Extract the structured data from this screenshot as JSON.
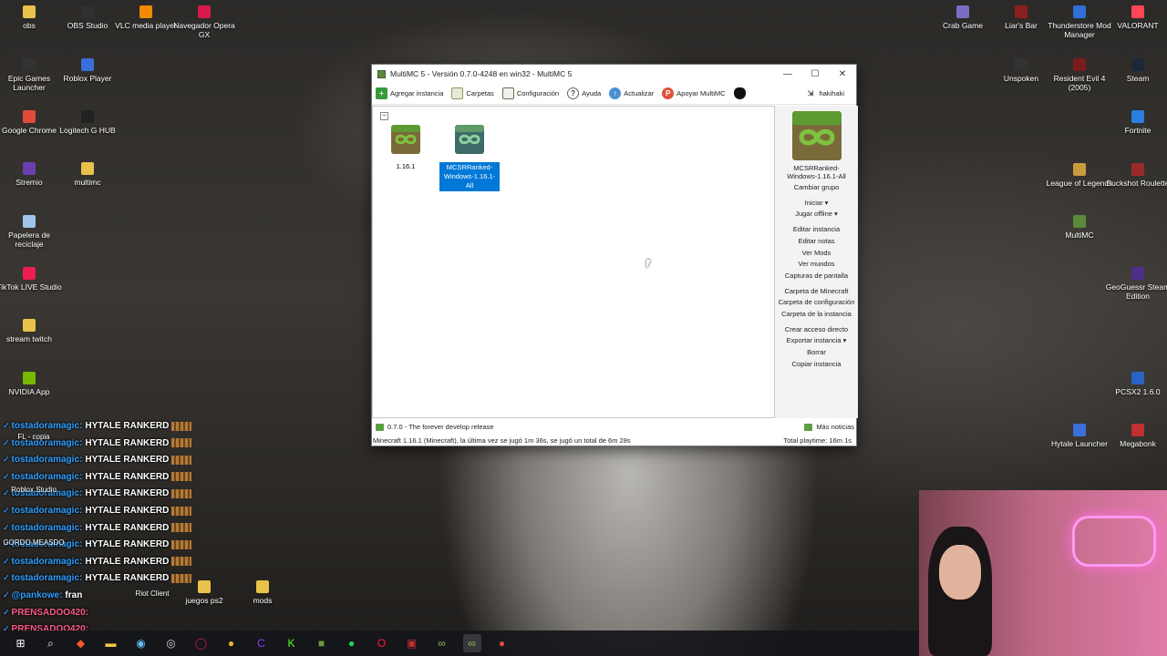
{
  "desktop": {
    "left_icons": [
      {
        "name": "obs-icon",
        "label": "obs",
        "color": "#e8c24a"
      },
      {
        "name": "obs-studio-icon",
        "label": "OBS Studio",
        "color": "#303030"
      },
      {
        "name": "vlc-icon",
        "label": "VLC media player",
        "color": "#f08a00"
      },
      {
        "name": "opera-gx-icon",
        "label": "Navegador Opera GX",
        "color": "#d6194a"
      },
      {
        "name": "epic-games-icon",
        "label": "Epic Games Launcher",
        "color": "#333"
      },
      {
        "name": "roblox-player-icon",
        "label": "Roblox Player",
        "color": "#3b6fd8"
      },
      {
        "name": "chrome-icon",
        "label": "Google Chrome",
        "color": "#e04b3a"
      },
      {
        "name": "logitech-icon",
        "label": "Logitech G HUB",
        "color": "#222"
      },
      {
        "name": "stremio-icon",
        "label": "Stremio",
        "color": "#6a3fb0"
      },
      {
        "name": "folder-icon",
        "label": "multimc",
        "color": "#e8c24a"
      },
      {
        "name": "recycle-bin-icon",
        "label": "Papelera de reciclaje",
        "color": "#9fc4e8"
      },
      {
        "name": "tiktok-live-icon",
        "label": "TikTok LIVE Studio",
        "color": "#ee1d52"
      },
      {
        "name": "folder-icon",
        "label": "stream twitch",
        "color": "#e8c24a"
      },
      {
        "name": "nvidia-icon",
        "label": "NVIDIA App",
        "color": "#76b900"
      }
    ],
    "right_icons": [
      {
        "name": "crab-game-icon",
        "label": "Crab Game",
        "color": "#7a6cc4"
      },
      {
        "name": "liars-bar-icon",
        "label": "Liar's Bar",
        "color": "#8a2020"
      },
      {
        "name": "thunderstore-icon",
        "label": "Thunderstore Mod Manager",
        "color": "#2e6fd8"
      },
      {
        "name": "valorant-icon",
        "label": "VALORANT",
        "color": "#ff4655"
      },
      {
        "name": "unspoken-icon",
        "label": "Unspoken",
        "color": "#333"
      },
      {
        "name": "resident-evil-icon",
        "label": "Resident Evil 4 (2005)",
        "color": "#7a1c1c"
      },
      {
        "name": "steam-icon",
        "label": "Steam",
        "color": "#1b2838"
      },
      {
        "name": "fortnite-icon",
        "label": "Fortnite",
        "color": "#2b7de0"
      },
      {
        "name": "league-icon",
        "label": "League of Legends",
        "color": "#c89b3c"
      },
      {
        "name": "buckshot-icon",
        "label": "Buckshot Roulette",
        "color": "#9a2a2a"
      },
      {
        "name": "multimc-icon",
        "label": "MultiMC",
        "color": "#5c8a3a"
      },
      {
        "name": "geoguessr-icon",
        "label": "GeoGuessr Steam Edition",
        "color": "#4d2f8a"
      },
      {
        "name": "pcsx2-icon",
        "label": "PCSX2 1.6.0",
        "color": "#2b63c4"
      },
      {
        "name": "hytale-icon",
        "label": "Hytale Launcher",
        "color": "#3a6fd8"
      },
      {
        "name": "megabonk-icon",
        "label": "Megabonk",
        "color": "#c03030"
      }
    ],
    "bottom_icons": [
      {
        "name": "folder-icon",
        "label": "juegos ps2",
        "color": "#e8c24a"
      },
      {
        "name": "folder-icon",
        "label": "mods",
        "color": "#e8c24a"
      }
    ]
  },
  "window": {
    "title": "MultiMC 5 - Versión 0.7.0-4248 en win32 - MultiMC 5",
    "controls": [
      "—",
      "☐",
      "✕"
    ],
    "toolbar": {
      "add_instance": "Agregar instancia",
      "folders": "Carpetas",
      "settings": "Configuración",
      "help": "Ayuda",
      "update": "Actualizar",
      "support": "Apoyar MultiMC",
      "account": "hakihaki"
    },
    "instances": [
      {
        "label": "1.16.1",
        "selected": false
      },
      {
        "label": "MCSRRanked-Windows-1.16.1-All",
        "selected": true
      }
    ],
    "sidebar": {
      "instance_name": "MCSRRanked-Windows-1.16.1-All",
      "change_group": "Cambiar grupo",
      "launch": "Iniciar",
      "play_offline": "Jugar offline",
      "edit_instance": "Editar instancia",
      "edit_notes": "Editar notas",
      "view_mods": "Ver Mods",
      "view_worlds": "Ver mundos",
      "screenshots": "Capturas de pantalla",
      "minecraft_folder": "Carpeta de Minecraft",
      "config_folder": "Carpeta de configuración",
      "instance_folder": "Carpeta de la instancia",
      "create_shortcut": "Crear acceso directo",
      "export_instance": "Exportar instancia",
      "delete": "Borrar",
      "copy_instance": "Copiar instancia"
    },
    "status": {
      "news": "0.7.0 - The forever develop release",
      "more_news": "Más noticias",
      "last_played": "Minecraft 1.16.1 (Minecraft), la última vez se jugó 1m 36s, se jugó un total de 6m 28s",
      "total_playtime": "Total playtime: 16m 1s"
    }
  },
  "chat": {
    "messages": [
      {
        "user": "tostadoramagic:",
        "text": "HYTALE RANKERD"
      },
      {
        "user": "tostadoramagic:",
        "text": "HYTALE RANKERD"
      },
      {
        "user": "tostadoramagic:",
        "text": "HYTALE RANKERD"
      },
      {
        "user": "tostadoramagic:",
        "text": "HYTALE RANKERD"
      },
      {
        "user": "tostadoramagic:",
        "text": "HYTALE RANKERD"
      },
      {
        "user": "tostadoramagic:",
        "text": "HYTALE RANKERD"
      },
      {
        "user": "tostadoramagic:",
        "text": "HYTALE RANKERD"
      },
      {
        "user": "tostadoramagic:",
        "text": "HYTALE RANKERD"
      },
      {
        "user": "tostadoramagic:",
        "text": "HYTALE RANKERD"
      },
      {
        "user": "tostadoramagic:",
        "text": "HYTALE RANKERD"
      },
      {
        "user": "@pankowe:",
        "text": "fran"
      },
      {
        "user": "PRENSADOO420:",
        "text": ""
      },
      {
        "user": "PRENSADOO420:",
        "text": ""
      }
    ],
    "overlap_labels": [
      "FL - copia",
      "Roblox Studio",
      "GORDO MEASDO",
      "Riot Client"
    ]
  },
  "taskbar": {
    "icons": [
      {
        "name": "start-icon",
        "glyph": "⊞",
        "color": "#ffffff"
      },
      {
        "name": "search-icon",
        "glyph": "⌕",
        "color": "#ffffff"
      },
      {
        "name": "brave-icon",
        "glyph": "◆",
        "color": "#fb542b"
      },
      {
        "name": "file-explorer-icon",
        "glyph": "▬",
        "color": "#f3c744"
      },
      {
        "name": "steam-icon",
        "glyph": "◉",
        "color": "#66c0f4"
      },
      {
        "name": "obs-icon",
        "glyph": "◎",
        "color": "#cfcfcf"
      },
      {
        "name": "opera-gx-icon",
        "glyph": "◯",
        "color": "#d6194a"
      },
      {
        "name": "chrome-icon",
        "glyph": "●",
        "color": "#e9b42a"
      },
      {
        "name": "canva-icon",
        "glyph": "C",
        "color": "#8b3dff"
      },
      {
        "name": "kick-icon",
        "glyph": "K",
        "color": "#53fc18"
      },
      {
        "name": "minecraft-icon",
        "glyph": "■",
        "color": "#6b9a3a"
      },
      {
        "name": "spotify-icon",
        "glyph": "●",
        "color": "#1ed760"
      },
      {
        "name": "opera-icon",
        "glyph": "O",
        "color": "#ff1b2d"
      },
      {
        "name": "game-icon",
        "glyph": "▣",
        "color": "#c03030"
      },
      {
        "name": "multimc-icon",
        "glyph": "∞",
        "color": "#8abf4a"
      },
      {
        "name": "multimc-active-icon",
        "glyph": "∞",
        "color": "#8abf4a"
      },
      {
        "name": "chrome-icon",
        "glyph": "●",
        "color": "#e04b3a"
      }
    ]
  }
}
